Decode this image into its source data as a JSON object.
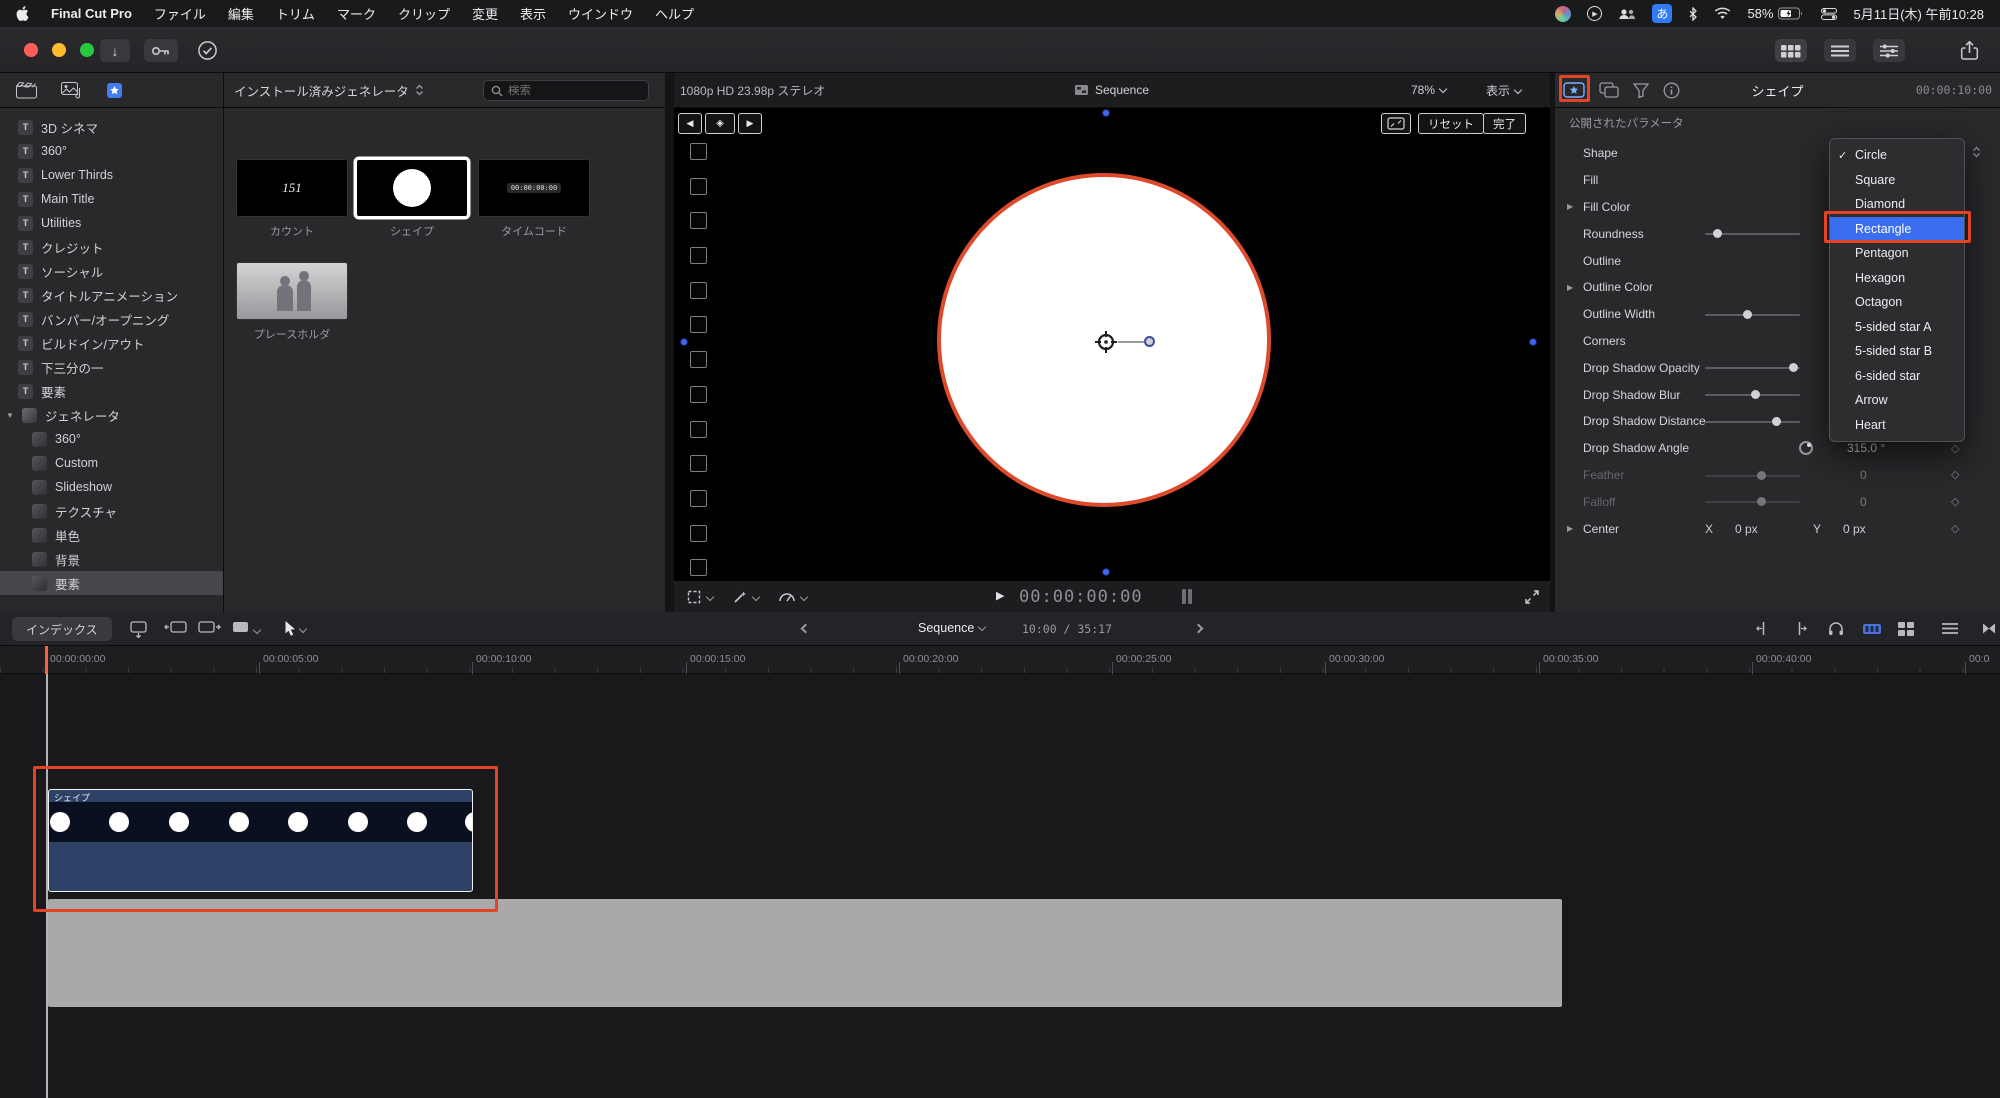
{
  "menubar": {
    "app_name": "Final Cut Pro",
    "menus": [
      "ファイル",
      "編集",
      "トリム",
      "マーク",
      "クリップ",
      "変更",
      "表示",
      "ウインドウ",
      "ヘルプ"
    ],
    "battery": "58%",
    "ime_badge": "あ",
    "datetime": "5月11日(木) 午前10:28"
  },
  "sidebar": {
    "title_items": [
      "3D シネマ",
      "360°",
      "Lower Thirds",
      "Main Title",
      "Utilities",
      "クレジット",
      "ソーシャル",
      "タイトルアニメーション",
      "バンパー/オープニング",
      "ビルドイン/アウト",
      "下三分の一",
      "要素"
    ],
    "generators_label": "ジェネレータ",
    "generator_items": [
      "360°",
      "Custom",
      "Slideshow",
      "テクスチャ",
      "単色",
      "背景",
      "要素"
    ]
  },
  "browser": {
    "title": "インストール済みジェネレータ",
    "search_placeholder": "検索",
    "items": [
      {
        "label": "カウント",
        "thumb_text": "151"
      },
      {
        "label": "シェイプ"
      },
      {
        "label": "タイムコード",
        "thumb_text": "00:00:00:00"
      },
      {
        "label": "プレースホルダ"
      }
    ]
  },
  "viewer": {
    "format_info": "1080p HD 23.98p ステレオ",
    "project_name": "Sequence",
    "zoom_level": "78%",
    "view_menu": "表示",
    "reset_button": "リセット",
    "done_button": "完了",
    "timecode": "00:00:00:00"
  },
  "inspector": {
    "tab_title": "シェイプ",
    "duration": "00:00:10:00",
    "section_title": "公開されたパラメータ",
    "params": [
      {
        "label": "Shape"
      },
      {
        "label": "Fill"
      },
      {
        "label": "Fill Color"
      },
      {
        "label": "Roundness"
      },
      {
        "label": "Outline"
      },
      {
        "label": "Outline Color"
      },
      {
        "label": "Outline Width"
      },
      {
        "label": "Corners"
      },
      {
        "label": "Drop Shadow Opacity"
      },
      {
        "label": "Drop Shadow Blur"
      },
      {
        "label": "Drop Shadow Distance"
      },
      {
        "label": "Drop Shadow Angle",
        "value": "315.0 °"
      },
      {
        "label": "Feather",
        "value": "0"
      },
      {
        "label": "Falloff",
        "value": "0"
      },
      {
        "label": "Center",
        "x_label": "X",
        "x_value": "0 px",
        "y_label": "Y",
        "y_value": "0 px"
      }
    ],
    "shape_menu": {
      "checked_item": "Circle",
      "highlighted_item": "Rectangle",
      "items": [
        "Circle",
        "Square",
        "Diamond",
        "Rectangle",
        "Pentagon",
        "Hexagon",
        "Octagon",
        "5-sided star A",
        "5-sided star B",
        "6-sided star",
        "Arrow",
        "Heart"
      ]
    }
  },
  "timeline": {
    "index_button": "インデックス",
    "sequence_name": "Sequence",
    "position_info": "10:00 / 35:17",
    "ruler_labels": [
      "00:00:00:00",
      "00:00:05:00",
      "00:00:10:00",
      "00:00:15:00",
      "00:00:20:00",
      "00:00:25:00",
      "00:00:30:00",
      "00:00:35:00",
      "00:00:40:00",
      "00:0"
    ],
    "clip_label": "シェイプ"
  }
}
